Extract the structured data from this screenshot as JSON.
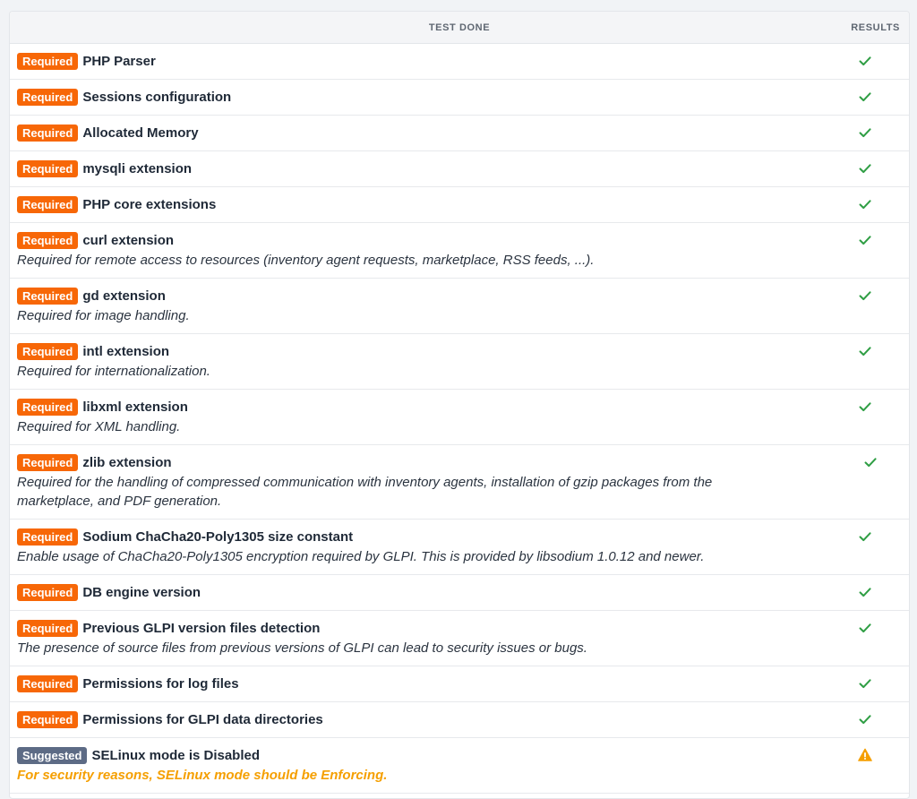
{
  "header": {
    "test_label": "TEST DONE",
    "results_label": "RESULTS"
  },
  "colors": {
    "required": "#f76707",
    "suggested": "#5d6b85",
    "success": "#2f9e44",
    "warning": "#f59f00"
  },
  "rows": [
    {
      "badge": "Required",
      "title": "PHP Parser",
      "desc": "",
      "status": "success"
    },
    {
      "badge": "Required",
      "title": "Sessions configuration",
      "desc": "",
      "status": "success"
    },
    {
      "badge": "Required",
      "title": "Allocated Memory",
      "desc": "",
      "status": "success"
    },
    {
      "badge": "Required",
      "title": "mysqli extension",
      "desc": "",
      "status": "success"
    },
    {
      "badge": "Required",
      "title": "PHP core extensions",
      "desc": "",
      "status": "success"
    },
    {
      "badge": "Required",
      "title": "curl extension",
      "desc": "Required for remote access to resources (inventory agent requests, marketplace, RSS feeds, ...).",
      "status": "success"
    },
    {
      "badge": "Required",
      "title": "gd extension",
      "desc": "Required for image handling.",
      "status": "success"
    },
    {
      "badge": "Required",
      "title": "intl extension",
      "desc": "Required for internationalization.",
      "status": "success"
    },
    {
      "badge": "Required",
      "title": "libxml extension",
      "desc": "Required for XML handling.",
      "status": "success"
    },
    {
      "badge": "Required",
      "title": "zlib extension",
      "desc": "Required for the handling of compressed communication with inventory agents, installation of gzip packages from the marketplace, and PDF generation.",
      "status": "success"
    },
    {
      "badge": "Required",
      "title": "Sodium ChaCha20-Poly1305 size constant",
      "desc": "Enable usage of ChaCha20-Poly1305 encryption required by GLPI. This is provided by libsodium 1.0.12 and newer.",
      "status": "success"
    },
    {
      "badge": "Required",
      "title": "DB engine version",
      "desc": "",
      "status": "success"
    },
    {
      "badge": "Required",
      "title": "Previous GLPI version files detection",
      "desc": "The presence of source files from previous versions of GLPI can lead to security issues or bugs.",
      "status": "success"
    },
    {
      "badge": "Required",
      "title": "Permissions for log files",
      "desc": "",
      "status": "success"
    },
    {
      "badge": "Required",
      "title": "Permissions for GLPI data directories",
      "desc": "",
      "status": "success"
    },
    {
      "badge": "Suggested",
      "title": "SELinux mode is Disabled",
      "desc": "For security reasons, SELinux mode should be Enforcing.",
      "status": "warning"
    }
  ]
}
